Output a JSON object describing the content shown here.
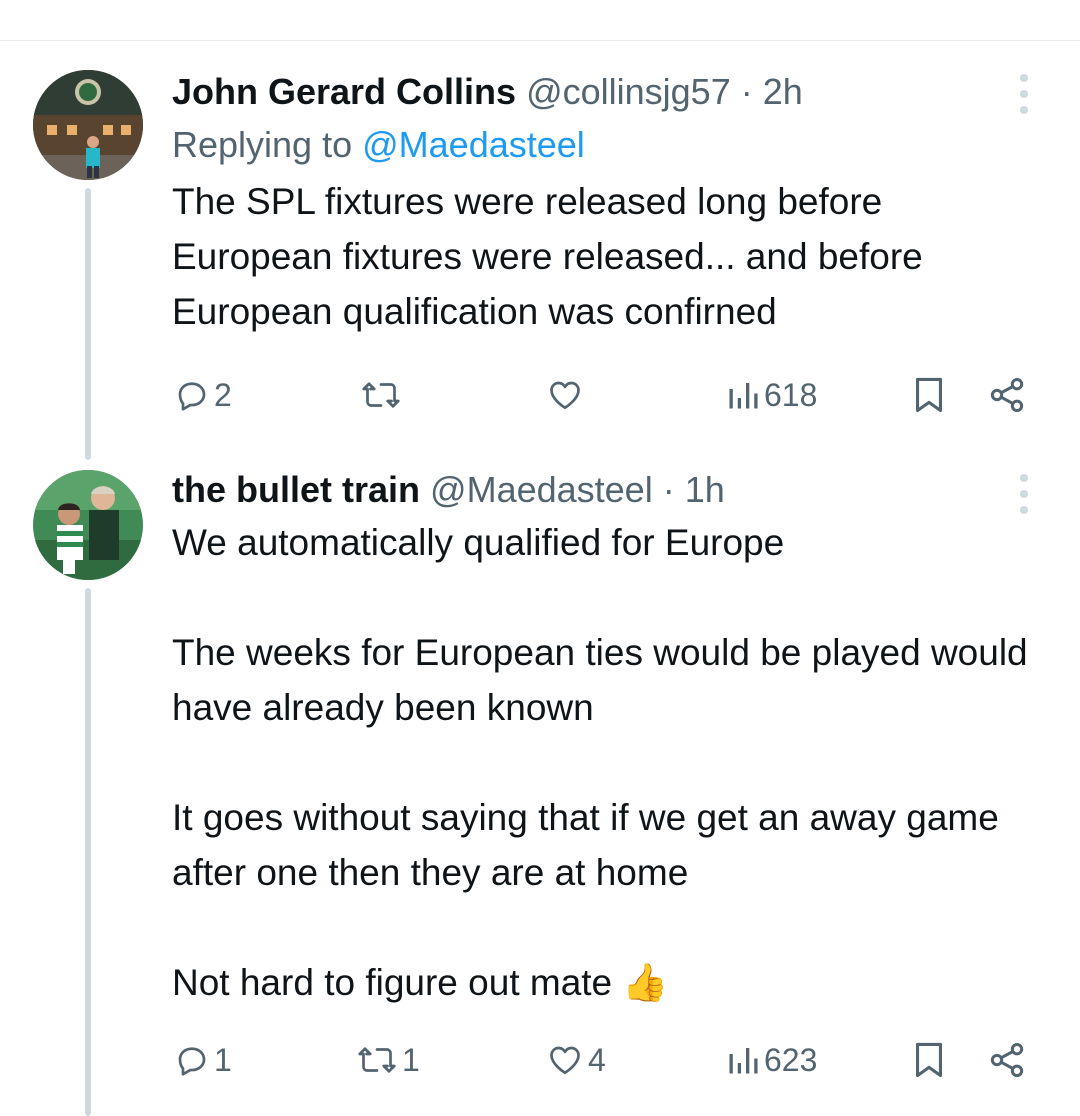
{
  "tweets": [
    {
      "display_name": "John Gerard Collins",
      "handle": "@collinsjg57",
      "separator": "·",
      "time": "2h",
      "replying_prefix": "Replying to",
      "replying_to": "@Maedasteel",
      "text": "The SPL fixtures were released long before European fixtures were released... and before European qualification was confirned",
      "stats": {
        "replies": "2",
        "retweets": "",
        "likes": "",
        "views": "618"
      },
      "avatar_icon": "celtic-park-photo"
    },
    {
      "display_name": "the bullet train",
      "handle": "@Maedasteel",
      "separator": "·",
      "time": "1h",
      "text": "We automatically qualified for Europe\n\nThe weeks for European ties would be played would have already been known\n\nIt goes without saying that if we get an away game after one then they are at home\n\nNot hard to figure out mate 👍",
      "stats": {
        "replies": "1",
        "retweets": "1",
        "likes": "4",
        "views": "623"
      },
      "avatar_icon": "celtic-fans-photo"
    }
  ],
  "colors": {
    "text": "#0f1419",
    "muted": "#536471",
    "link": "#1d9bf0",
    "thread_line": "#cfd9de"
  }
}
